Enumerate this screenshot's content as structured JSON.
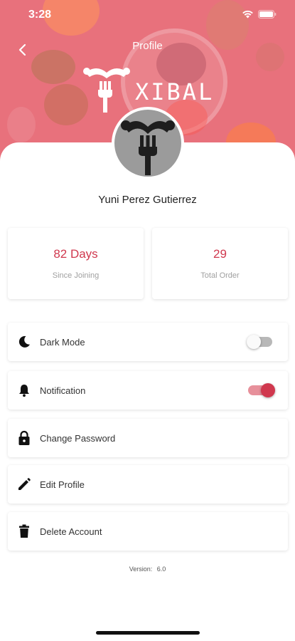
{
  "status_bar": {
    "time": "3:28"
  },
  "header": {
    "title": "Profile",
    "logo_text": "XIBAL"
  },
  "profile": {
    "name": "Yuni Perez Gutierrez"
  },
  "stats": [
    {
      "value": "82 Days",
      "label": "Since Joining"
    },
    {
      "value": "29",
      "label": "Total Order"
    }
  ],
  "settings": [
    {
      "label": "Dark Mode",
      "icon": "moon-icon",
      "toggle": false
    },
    {
      "label": "Notification",
      "icon": "bell-icon",
      "toggle": true
    },
    {
      "label": "Change Password",
      "icon": "lock-icon"
    },
    {
      "label": "Edit Profile",
      "icon": "pencil-icon"
    },
    {
      "label": "Delete Account",
      "icon": "trash-icon"
    }
  ],
  "footer": {
    "version_label": "Version:",
    "version_value": "6.0"
  },
  "colors": {
    "accent": "#d0384e",
    "header_tint": "#e8717c",
    "avatar_bg": "#9b9b9b"
  }
}
